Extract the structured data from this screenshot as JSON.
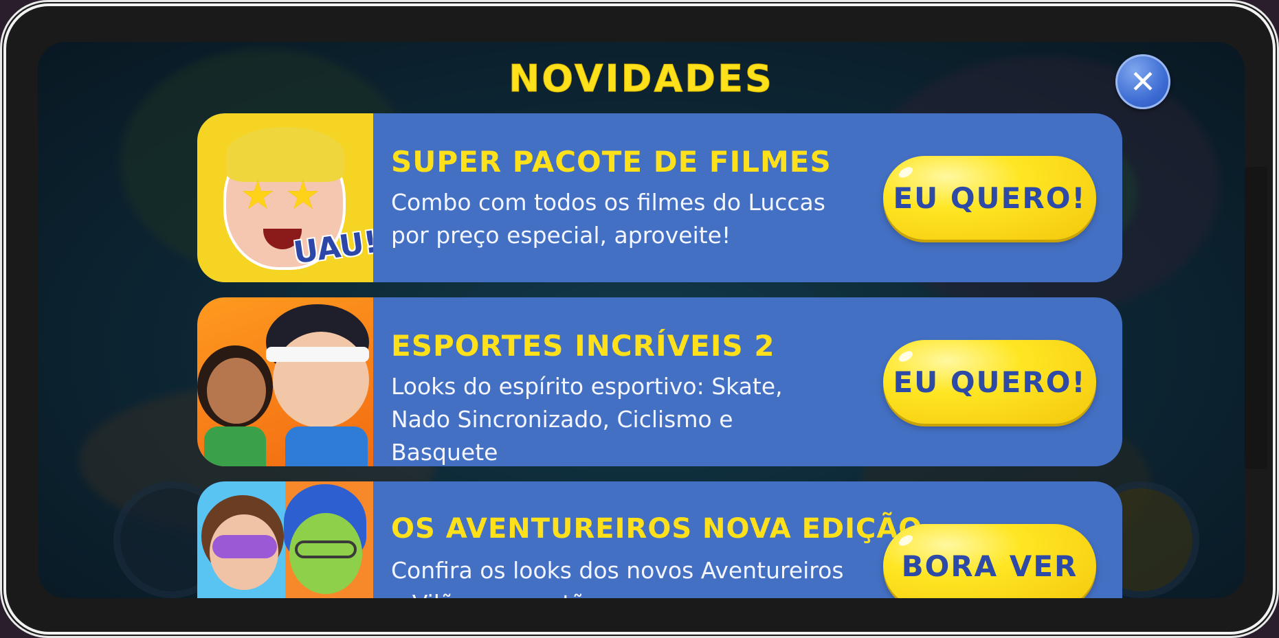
{
  "modal": {
    "title": "NOVIDADES",
    "close_label": "✕"
  },
  "offers": [
    {
      "title": "SUPER PACOTE DE FILMES",
      "description": "Combo com todos os filmes do Luccas por preço especial, aproveite!",
      "button_label": "EU QUERO!",
      "thumbnail_badge": "UAU!"
    },
    {
      "title": "ESPORTES INCRÍVEIS 2",
      "description": "Looks do espírito esportivo: Skate, Nado Sincronizado, Ciclismo e Basquete",
      "button_label": "EU QUERO!"
    },
    {
      "title": "OS AVENTUREIROS NOVA EDIÇÃO",
      "description": "Confira os looks dos novos Aventureiros e Vilões que estão",
      "button_label": "BORA VER"
    }
  ],
  "colors": {
    "title_yellow": "#ffe11b",
    "card_blue": "#4470c4",
    "button_yellow": "#ffe623",
    "button_text_blue": "#2d4aa6"
  }
}
